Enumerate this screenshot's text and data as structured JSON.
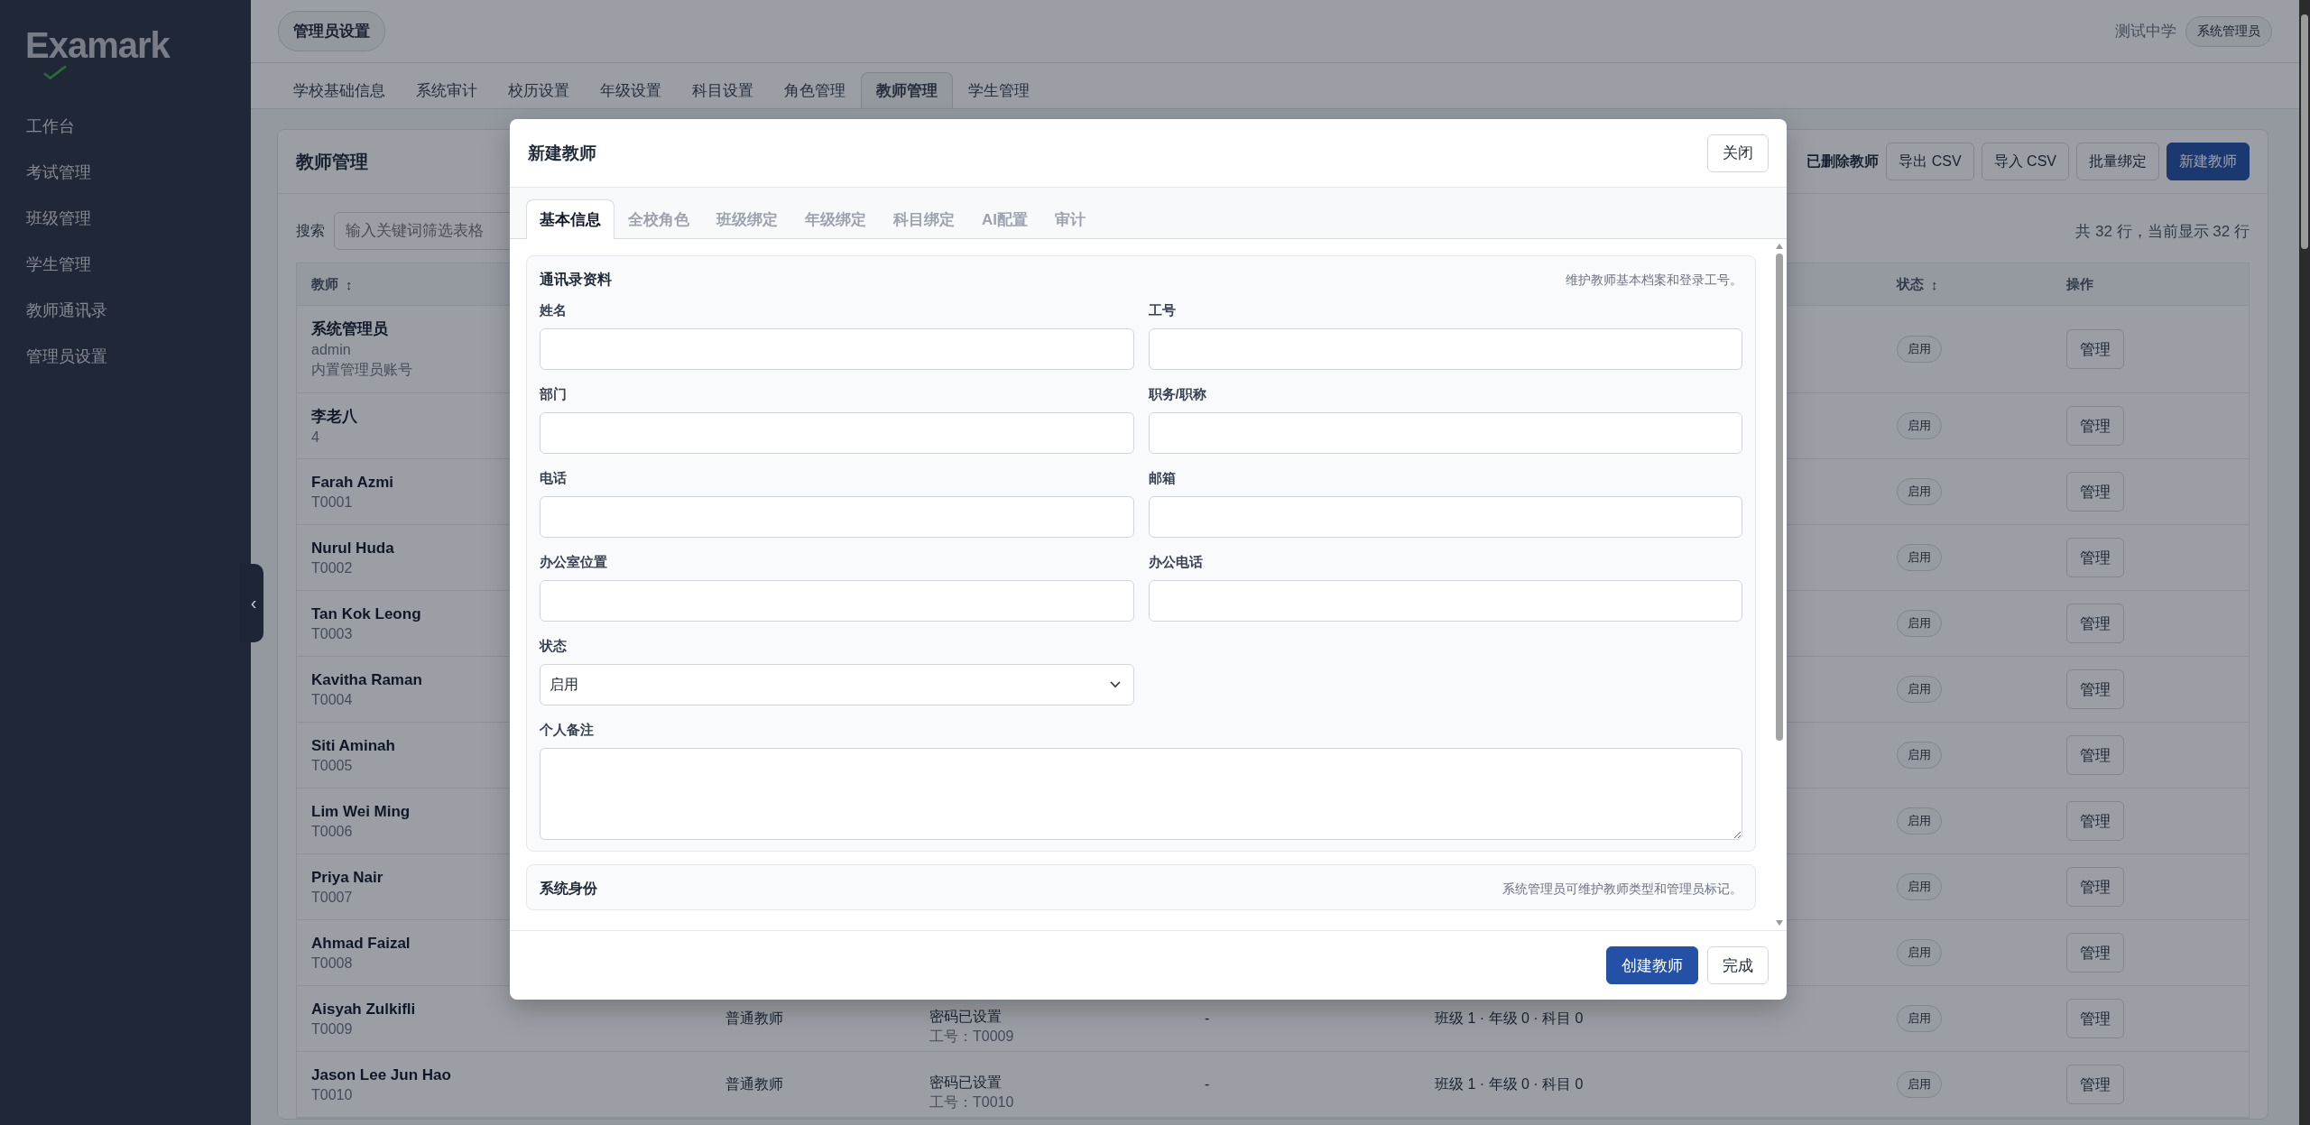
{
  "sidebar": {
    "logo": "Examark",
    "items": [
      {
        "label": "工作台"
      },
      {
        "label": "考试管理"
      },
      {
        "label": "班级管理"
      },
      {
        "label": "学生管理"
      },
      {
        "label": "教师通讯录"
      },
      {
        "label": "管理员设置"
      }
    ],
    "toggle": "‹"
  },
  "topbar": {
    "breadcrumb": "管理员设置",
    "school": "测试中学",
    "role": "系统管理员"
  },
  "tabs": [
    {
      "label": "学校基础信息",
      "selected": false
    },
    {
      "label": "系统审计",
      "selected": false
    },
    {
      "label": "校历设置",
      "selected": false
    },
    {
      "label": "年级设置",
      "selected": false
    },
    {
      "label": "科目设置",
      "selected": false
    },
    {
      "label": "角色管理",
      "selected": false
    },
    {
      "label": "教师管理",
      "selected": true
    },
    {
      "label": "学生管理",
      "selected": false
    }
  ],
  "panel": {
    "title": "教师管理",
    "toolbar": [
      {
        "label": "已删除教师",
        "kind": "toggle"
      },
      {
        "label": "导出 CSV",
        "kind": "button"
      },
      {
        "label": "导入 CSV",
        "kind": "button"
      },
      {
        "label": "批量绑定",
        "kind": "button"
      },
      {
        "label": "新建教师",
        "kind": "primary"
      }
    ],
    "search": {
      "label": "搜索",
      "placeholder": "输入关键词筛选表格"
    },
    "row_count": "共 32 行，当前显示 32 行",
    "table": {
      "columns": [
        {
          "label": "教师",
          "sort": "↕"
        },
        {
          "label": "状态",
          "sort": "↕"
        },
        {
          "label": "操作"
        }
      ],
      "rows": [
        {
          "name": "系统管理员",
          "sub": [
            "admin",
            "内置管理员账号"
          ],
          "status": "启用",
          "action": "管理"
        },
        {
          "name": "李老八",
          "sub": [
            "4"
          ],
          "status": "启用",
          "action": "管理"
        },
        {
          "name": "Farah Azmi",
          "sub": [
            "T0001"
          ],
          "status": "启用",
          "action": "管理"
        },
        {
          "name": "Nurul Huda",
          "sub": [
            "T0002"
          ],
          "status": "启用",
          "action": "管理"
        },
        {
          "name": "Tan Kok Leong",
          "sub": [
            "T0003"
          ],
          "status": "启用",
          "action": "管理"
        },
        {
          "name": "Kavitha Raman",
          "sub": [
            "T0004"
          ],
          "status": "启用",
          "action": "管理"
        },
        {
          "name": "Siti Aminah",
          "sub": [
            "T0005"
          ],
          "status": "启用",
          "action": "管理"
        },
        {
          "name": "Lim Wei Ming",
          "sub": [
            "T0006"
          ],
          "status": "启用",
          "action": "管理"
        },
        {
          "name": "Priya Nair",
          "sub": [
            "T0007"
          ],
          "status": "启用",
          "action": "管理"
        },
        {
          "name": "Ahmad Faizal",
          "sub": [
            "T0008"
          ],
          "status": "启用",
          "action": "管理"
        },
        {
          "name": "Aisyah Zulkifli",
          "sub": [
            "T0009"
          ],
          "type": "普通教师",
          "account": [
            "密码已设置",
            "工号：T0009"
          ],
          "column_4": "-",
          "bindings": "班级 1 · 年级 0 · 科目 0",
          "status": "启用",
          "action": "管理"
        },
        {
          "name": "Jason Lee Jun Hao",
          "sub": [
            "T0010"
          ],
          "type": "普通教师",
          "account": [
            "密码已设置",
            "工号：T0010"
          ],
          "column_4": "-",
          "bindings": "班级 1 · 年级 0 · 科目 0",
          "status": "启用",
          "action": "管理"
        }
      ]
    }
  },
  "modal": {
    "title": "新建教师",
    "close": "关闭",
    "tabs": [
      {
        "label": "基本信息",
        "selected": true
      },
      {
        "label": "全校角色",
        "selected": false
      },
      {
        "label": "班级绑定",
        "selected": false
      },
      {
        "label": "年级绑定",
        "selected": false
      },
      {
        "label": "科目绑定",
        "selected": false
      },
      {
        "label": "AI配置",
        "selected": false
      },
      {
        "label": "审计",
        "selected": false
      }
    ],
    "sections": [
      {
        "title": "通讯录资料",
        "hint": "维护教师基本档案和登录工号。",
        "fields": [
          {
            "label": "姓名",
            "kind": "text"
          },
          {
            "label": "工号",
            "kind": "text"
          },
          {
            "label": "部门",
            "kind": "text"
          },
          {
            "label": "职务/职称",
            "kind": "text"
          },
          {
            "label": "电话",
            "kind": "text"
          },
          {
            "label": "邮箱",
            "kind": "text"
          },
          {
            "label": "办公室位置",
            "kind": "text"
          },
          {
            "label": "办公电话",
            "kind": "text"
          },
          {
            "label": "状态",
            "kind": "select",
            "value": "启用"
          },
          {
            "label": "个人备注",
            "kind": "textarea"
          }
        ]
      },
      {
        "title": "系统身份",
        "hint": "系统管理员可维护教师类型和管理员标记。"
      }
    ],
    "buttons": [
      {
        "label": "创建教师",
        "kind": "primary"
      },
      {
        "label": "完成",
        "kind": "secondary"
      }
    ]
  }
}
